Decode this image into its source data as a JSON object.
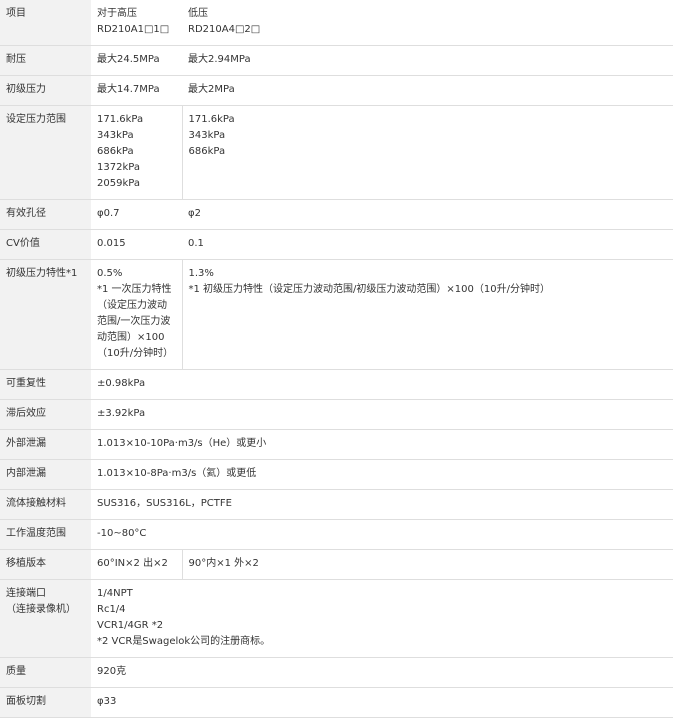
{
  "rows": [
    {
      "label": "项目",
      "c1": [
        "对于高压",
        "RD210A1□1□"
      ],
      "c2": [
        "低压",
        "RD210A4□2□"
      ]
    },
    {
      "label": "耐压",
      "c1": [
        "最大24.5MPa"
      ],
      "c2": [
        "最大2.94MPa"
      ]
    },
    {
      "label": "初级压力",
      "c1": [
        "最大14.7MPa"
      ],
      "c2": [
        "最大2MPa"
      ]
    },
    {
      "label": "设定压力范围",
      "c1": [
        "171.6kPa",
        "343kPa",
        "686kPa",
        "1372kPa",
        "2059kPa"
      ],
      "c2": [
        "171.6kPa",
        "343kPa",
        "686kPa"
      ]
    },
    {
      "label": "有效孔径",
      "c1": [
        "φ0.7"
      ],
      "c2": [
        "φ2"
      ]
    },
    {
      "label": "CV价值",
      "c1": [
        "0.015"
      ],
      "c2": [
        "0.1"
      ]
    },
    {
      "label": "初级压力特性*1",
      "c1_head": "0.5%",
      "c1_note": "*1 一次压力特性（设定压力波动范围/一次压力波动范围）×100（10升/分钟时）",
      "c2": [
        "1.3%",
        "*1 初级压力特性（设定压力波动范围/初级压力波动范围）×100（10升/分钟时）"
      ]
    },
    {
      "label": "可重复性",
      "value": "±0.98kPa"
    },
    {
      "label": "滞后效应",
      "value": "±3.92kPa"
    },
    {
      "label": "外部泄漏",
      "value": "1.013×10-10Pa·m3/s（He）或更小"
    },
    {
      "label": "内部泄漏",
      "value": "1.013×10-8Pa·m3/s（氦）或更低"
    },
    {
      "label": "流体接触材料",
      "value": "SUS316，SUS316L，PCTFE"
    },
    {
      "label": "工作温度范围",
      "value": "-10~80°C"
    },
    {
      "label": "移植版本",
      "c1": [
        "60°IN×2 出×2"
      ],
      "c2": [
        "90°内×1 外×2"
      ]
    },
    {
      "label_lines": [
        "连接端口",
        "（连接录像机）"
      ],
      "value_lines": [
        "1/4NPT",
        "Rc1/4",
        "VCR1/4GR *2",
        "*2 VCR是Swagelok公司的注册商标。"
      ]
    },
    {
      "label": "质量",
      "value": "920克"
    },
    {
      "label": "面板切割",
      "value": "φ33"
    }
  ]
}
